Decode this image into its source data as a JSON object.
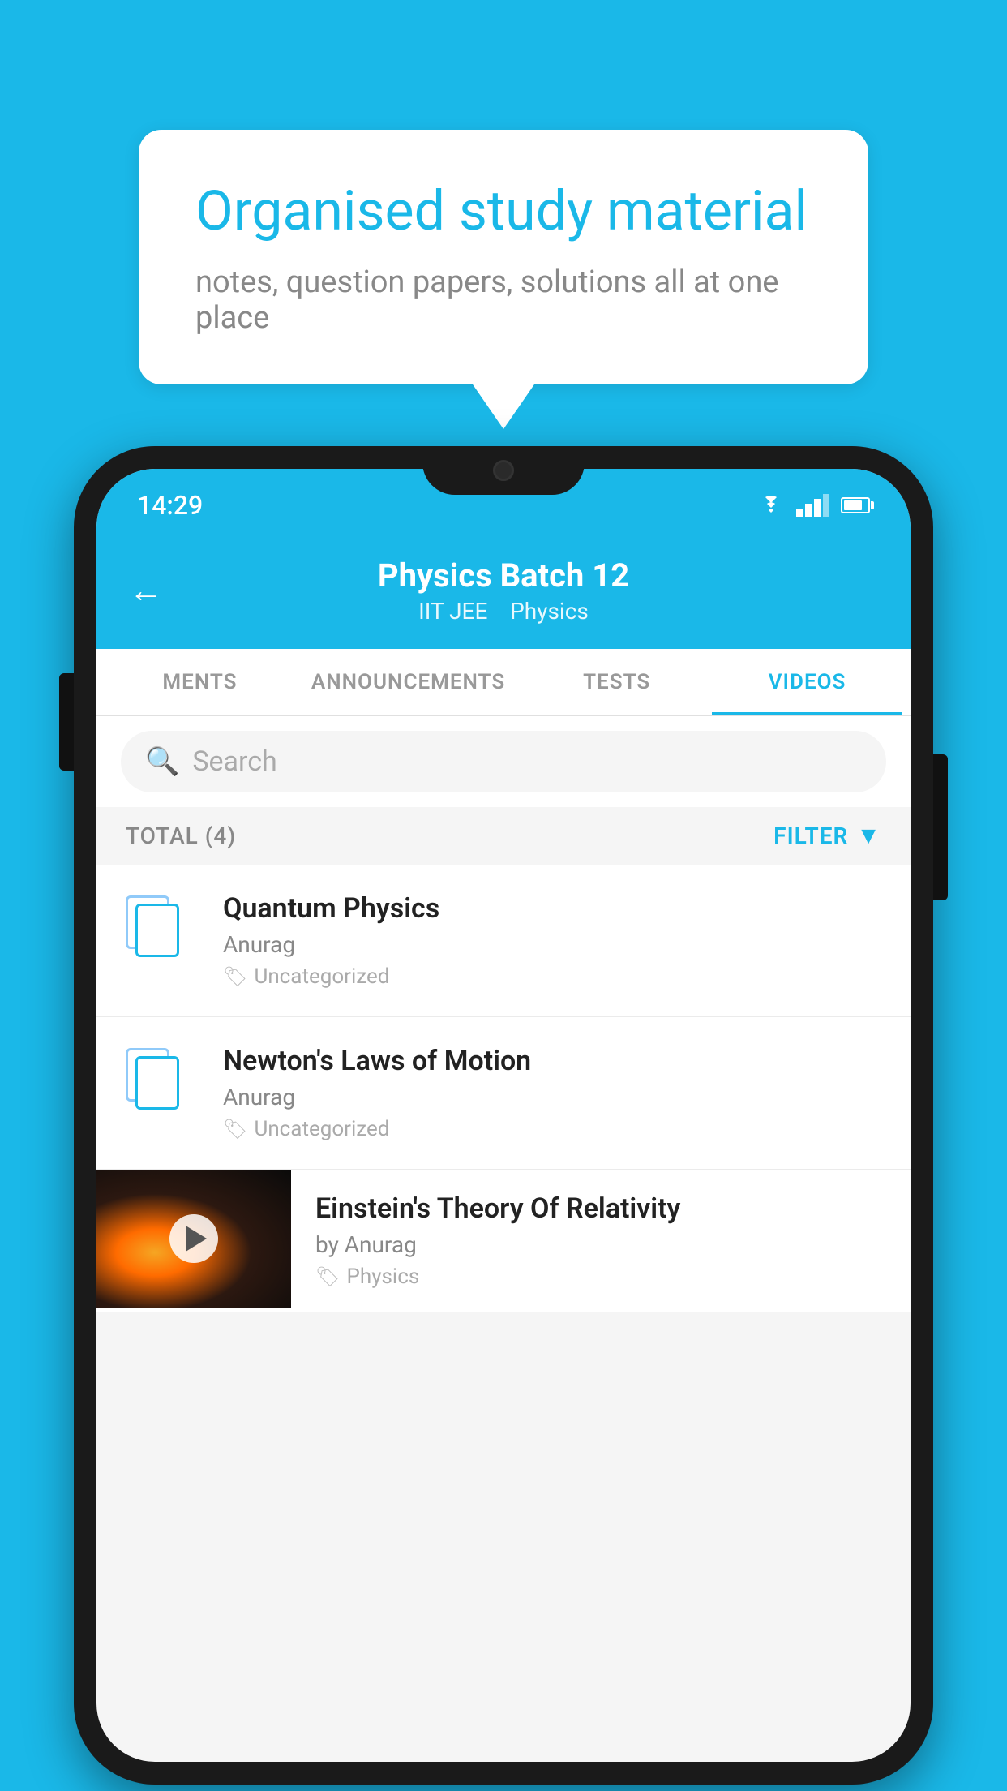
{
  "background": {
    "color": "#1ab8e8"
  },
  "hero": {
    "bubble_title": "Organised study material",
    "bubble_subtitle": "notes, question papers, solutions all at one place"
  },
  "status_bar": {
    "time": "14:29",
    "wifi": "▼",
    "battery_label": "battery"
  },
  "app_header": {
    "back_label": "←",
    "title": "Physics Batch 12",
    "subtitle_part1": "IIT JEE",
    "subtitle_part2": "Physics"
  },
  "tabs": [
    {
      "label": "MENTS",
      "active": false
    },
    {
      "label": "ANNOUNCEMENTS",
      "active": false
    },
    {
      "label": "TESTS",
      "active": false
    },
    {
      "label": "VIDEOS",
      "active": true
    }
  ],
  "search": {
    "placeholder": "Search"
  },
  "filter": {
    "total_label": "TOTAL (4)",
    "filter_label": "FILTER"
  },
  "videos": [
    {
      "type": "document",
      "title": "Quantum Physics",
      "author": "Anurag",
      "tag": "Uncategorized"
    },
    {
      "type": "document",
      "title": "Newton's Laws of Motion",
      "author": "Anurag",
      "tag": "Uncategorized"
    },
    {
      "type": "video",
      "title": "Einstein's Theory Of Relativity",
      "author": "by Anurag",
      "tag": "Physics"
    }
  ]
}
